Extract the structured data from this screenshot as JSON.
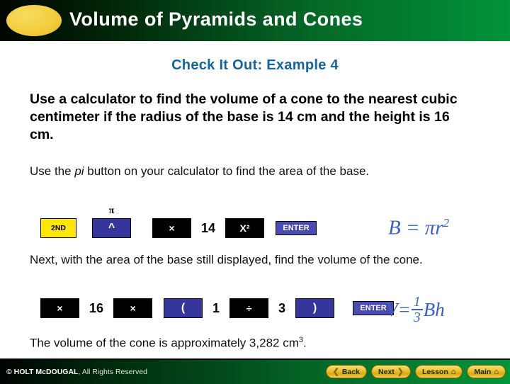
{
  "header": {
    "title": "Volume of Pyramids and Cones",
    "ellipse_icon": "gold-ellipse",
    "gradient_dark": "#000600",
    "gradient_green": "#019338",
    "ellipse_color": "#f3cd3c"
  },
  "slide": {
    "subtitle": "Check It Out: Example 4",
    "subtitle_color": "#1464a0",
    "problem": "Use a calculator to find the volume of a cone to the nearest cubic centimeter if the radius of the base is 14 cm and the height is 16 cm.",
    "step1": {
      "text_before": "Use the ",
      "text_italic": "pi",
      "text_after": " button on your calculator to find the area of the base.",
      "keys": [
        {
          "label": "2ND",
          "style": "yellow",
          "above": ""
        },
        {
          "label": "^",
          "style": "blue",
          "above": "π"
        },
        {
          "label": "×",
          "style": "black",
          "above": ""
        },
        {
          "label": "14",
          "style": "plain",
          "above": ""
        },
        {
          "label": "X²",
          "style": "black",
          "above": ""
        },
        {
          "label": "ENTER",
          "style": "enter",
          "above": ""
        }
      ],
      "formula": {
        "lhs": "B",
        "eq": " = ",
        "rhs_base": "πr",
        "rhs_exp": "2"
      }
    },
    "step2": {
      "text": "Next, with the area of the base still displayed, find the volume of the cone.",
      "keys": [
        {
          "label": "×",
          "style": "black",
          "above": ""
        },
        {
          "label": "16",
          "style": "plain",
          "above": ""
        },
        {
          "label": "×",
          "style": "black",
          "above": ""
        },
        {
          "label": "(",
          "style": "blue",
          "above": ""
        },
        {
          "label": "1",
          "style": "plain",
          "above": ""
        },
        {
          "label": "÷",
          "style": "black",
          "above": ""
        },
        {
          "label": "3",
          "style": "plain",
          "above": ""
        },
        {
          "label": ")",
          "style": "blue",
          "above": ""
        },
        {
          "label": "ENTER",
          "style": "enter",
          "above": ""
        }
      ],
      "formula": {
        "lhs": "V",
        "eq": " = ",
        "numerator": "1",
        "denominator": "3",
        "rhs": "Bh"
      }
    },
    "result": {
      "text_before": "The volume of the cone is approximately 3,282 cm",
      "exponent": "3",
      "text_after": "."
    }
  },
  "footer": {
    "copyright_strong": "© HOLT McDOUGAL",
    "copyright_light": ", All Rights Reserved",
    "buttons": [
      {
        "label": "Back",
        "lead_icon": "chevron-left-icon",
        "trail_icon": ""
      },
      {
        "label": "Next",
        "lead_icon": "",
        "trail_icon": "chevron-right-icon"
      },
      {
        "label": "Lesson",
        "lead_icon": "",
        "trail_icon": "home-icon"
      },
      {
        "label": "Main",
        "lead_icon": "",
        "trail_icon": "home-icon"
      }
    ],
    "button_color": "#ecc734"
  }
}
